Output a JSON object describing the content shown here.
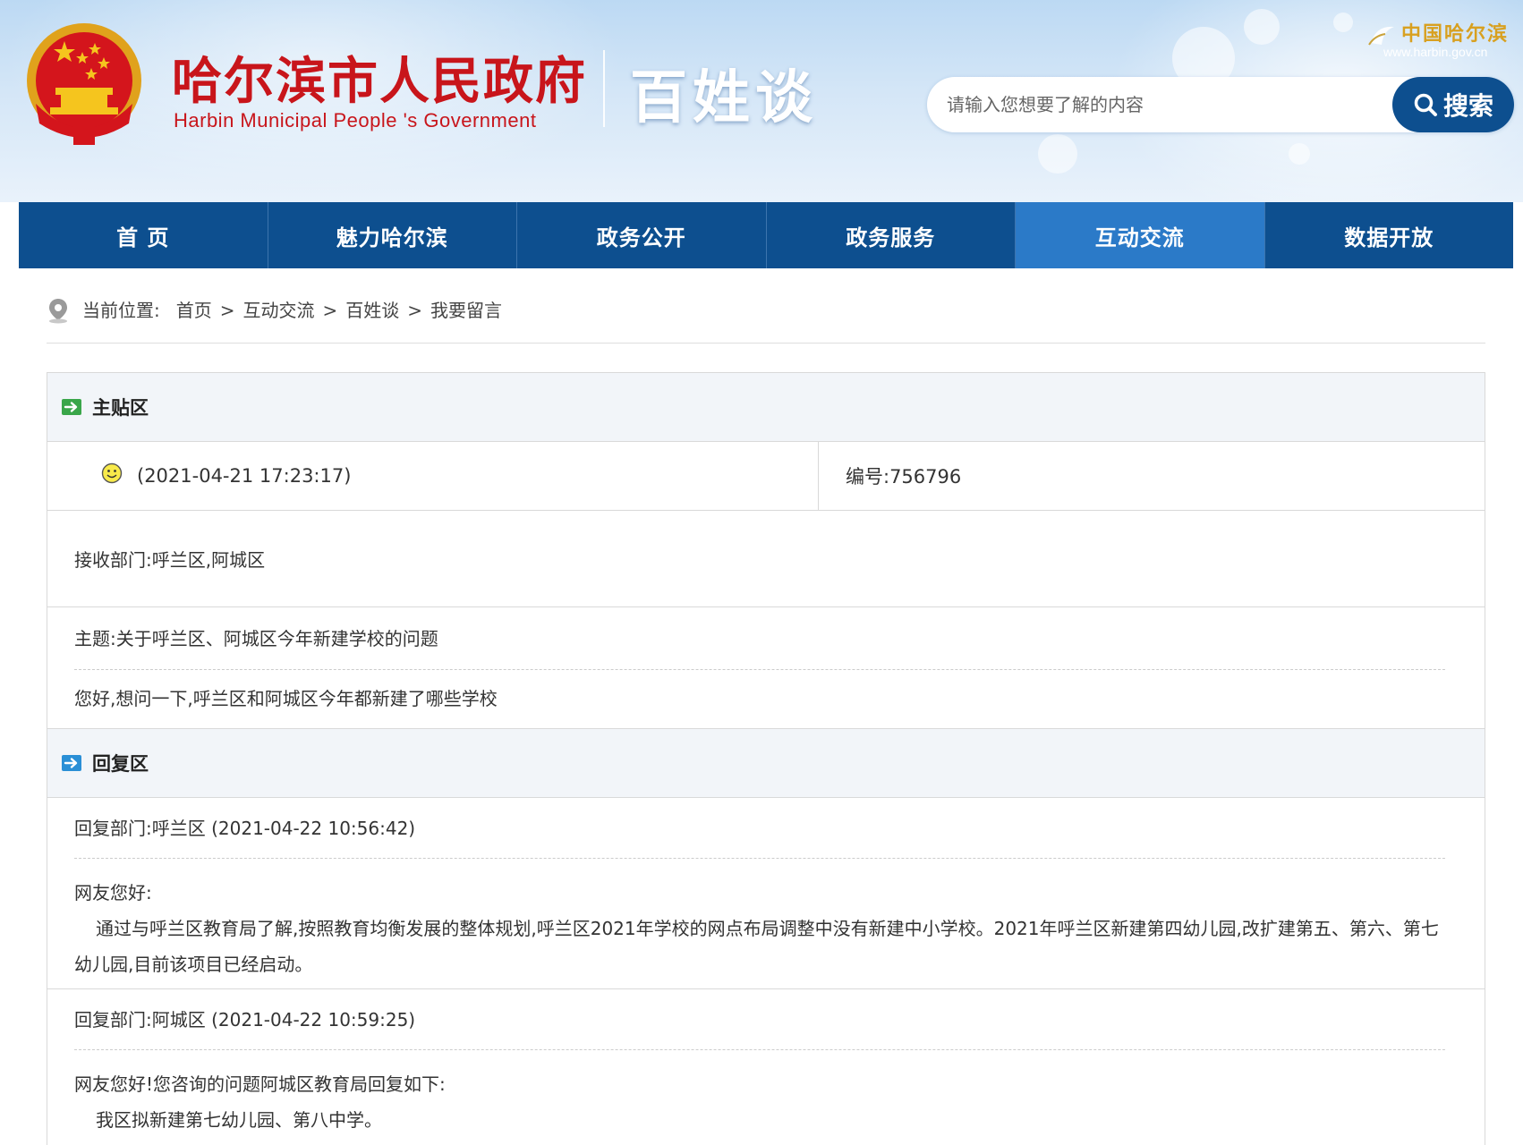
{
  "header": {
    "site_title": "哈尔滨市人民政府",
    "site_subtitle": "Harbin Municipal People 's Government",
    "section_title": "百姓谈",
    "gov_logo_cn": "中国哈尔滨",
    "gov_logo_url": "www.harbin.gov.cn",
    "search": {
      "placeholder": "请输入您想要了解的内容",
      "value": "",
      "button_label": "搜索"
    }
  },
  "nav": {
    "items": [
      {
        "label": "首 页"
      },
      {
        "label": "魅力哈尔滨"
      },
      {
        "label": "政务公开"
      },
      {
        "label": "政务服务"
      },
      {
        "label": "互动交流",
        "active": true
      },
      {
        "label": "数据开放"
      }
    ]
  },
  "breadcrumb": {
    "label": "当前位置:",
    "items": [
      "首页",
      "互动交流",
      "百姓谈",
      "我要留言"
    ],
    "separator": ">"
  },
  "main_post": {
    "section_title": "主贴区",
    "timestamp": "(2021-04-21 17:23:17)",
    "number_text": "编号:756796",
    "department_text": "接收部门:呼兰区,阿城区",
    "subject_text": "主题:关于呼兰区、阿城区今年新建学校的问题",
    "body": "您好,想问一下,呼兰区和阿城区今年都新建了哪些学校"
  },
  "replies": {
    "section_title": "回复区",
    "items": [
      {
        "meta": "回复部门:呼兰区 (2021-04-22 10:56:42)",
        "greeting": "网友您好:",
        "text": "通过与呼兰区教育局了解,按照教育均衡发展的整体规划,呼兰区2021年学校的网点布局调整中没有新建中小学校。2021年呼兰区新建第四幼儿园,改扩建第五、第六、第七幼儿园,目前该项目已经启动。"
      },
      {
        "meta": "回复部门:阿城区 (2021-04-22 10:59:25)",
        "greeting": "网友您好!您咨询的问题阿城区教育局回复如下:",
        "text": "我区拟新建第七幼儿园、第八中学。"
      }
    ]
  },
  "colors": {
    "brand_red": "#c8151b",
    "nav_blue": "#0d4f8f",
    "nav_active": "#2b7ac8",
    "section_bg": "#f2f5f9"
  }
}
